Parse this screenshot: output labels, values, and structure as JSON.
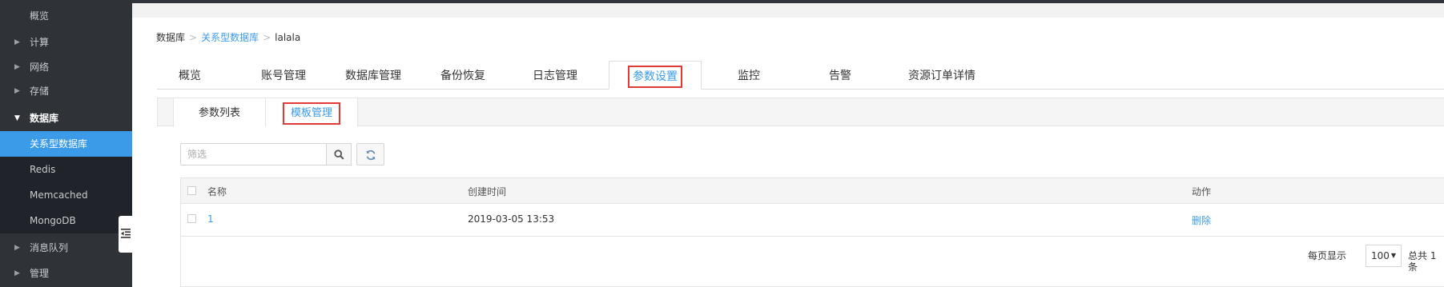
{
  "sidebar": {
    "overview": "概览",
    "compute": "计算",
    "network": "网络",
    "storage": "存储",
    "database": "数据库",
    "db_items": [
      "关系型数据库",
      "Redis",
      "Memcached",
      "MongoDB"
    ],
    "mq": "消息队列",
    "manage": "管理"
  },
  "breadcrumb": {
    "root": "数据库",
    "section": "关系型数据库",
    "current": "lalala"
  },
  "tabs": [
    "概览",
    "账号管理",
    "数据库管理",
    "备份恢复",
    "日志管理",
    "参数设置",
    "监控",
    "告警",
    "资源订单详情"
  ],
  "subtabs": [
    "参数列表",
    "模板管理"
  ],
  "filter": {
    "placeholder": "筛选"
  },
  "table": {
    "headers": {
      "name": "名称",
      "created": "创建时间",
      "action": "动作"
    },
    "rows": [
      {
        "name": "1",
        "created": "2019-03-05 13:53",
        "action": "删除"
      }
    ]
  },
  "pager": {
    "per_page_label": "每页显示",
    "per_page_value": "100",
    "total_label": "总共 1 条"
  },
  "colors": {
    "accent": "#3c9be8",
    "highlight": "#e53935",
    "sidebar_bg": "#2f3338"
  }
}
